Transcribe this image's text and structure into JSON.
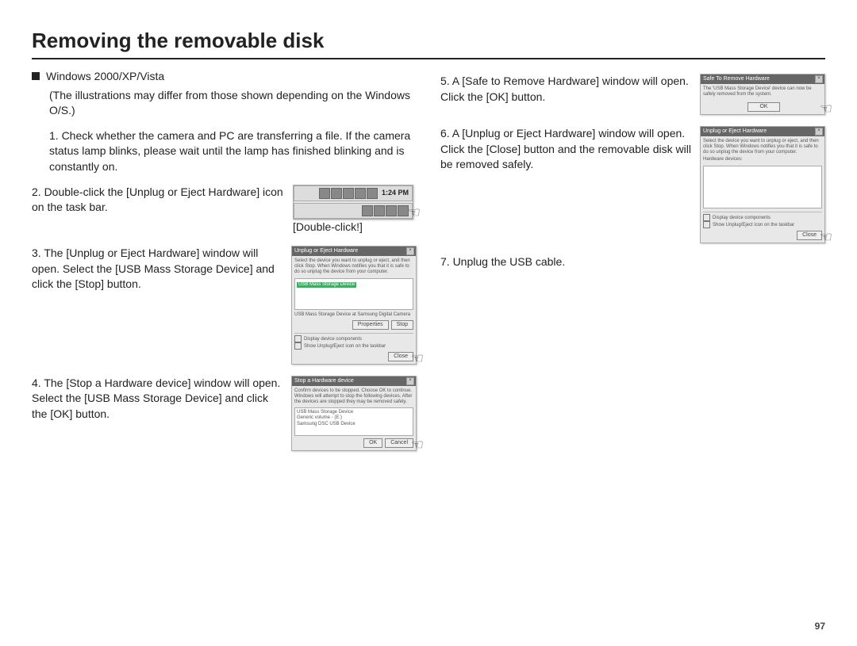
{
  "title": "Removing the removable disk",
  "page_number": "97",
  "left": {
    "platform": "Windows 2000/XP/Vista",
    "note": "(The illustrations may differ from those shown depending on the Windows O/S.)",
    "step1": "1. Check whether the camera and PC are transferring a file. If the camera status lamp blinks, please wait until the lamp has finished blinking and is constantly on.",
    "step2": "2. Double-click the [Unplug or Eject Hardware] icon on the task bar.",
    "taskbar_clock": "1:24 PM",
    "taskbar_caption": "[Double-click!]",
    "step3": "3. The [Unplug or Eject Hardware] window will open. Select the [USB Mass Storage Device] and click the [Stop] button.",
    "d3": {
      "title": "Unplug or Eject Hardware",
      "instr": "Select the device you want to unplug or eject, and then click Stop. When Windows notifies you that it is safe to do so unplug the device from your computer.",
      "list": "USB Mass Storage Device",
      "footer": "USB Mass Storage Device at Samsung Digital Camera",
      "check1": "Display device components",
      "check2": "Show Unplug/Eject icon on the taskbar",
      "btn_prop": "Properties",
      "btn_stop": "Stop",
      "btn_close": "Close"
    },
    "step4": "4. The [Stop a Hardware device] window will open. Select the [USB Mass Storage Device] and click the [OK] button.",
    "d4": {
      "title": "Stop a Hardware device",
      "instr": "Confirm devices to be stopped. Choose OK to continue. Windows will attempt to stop the following devices. After the devices are stopped they may be removed safely.",
      "item1": "USB Mass Storage Device",
      "item2": "Generic volume - (E:)",
      "item3": "Samsung DSC USB Device",
      "btn_ok": "OK",
      "btn_cancel": "Cancel"
    }
  },
  "right": {
    "step5": "5. A [Safe to Remove Hardware] window will open. Click the [OK] button.",
    "d5": {
      "title": "Safe To Remove Hardware",
      "msg": "The 'USB Mass Storage Device' device can now be safely removed from the system.",
      "btn_ok": "OK"
    },
    "step6": "6. A [Unplug or Eject Hardware] window will open. Click the [Close] button and the removable disk will be removed safely.",
    "d6": {
      "title": "Unplug or Eject Hardware",
      "instr": "Select the device you want to unplug or eject, and then click Stop. When Windows notifies you that it is safe to do so unplug the device from your computer.",
      "footer_label": "Hardware devices:",
      "check1": "Display device components",
      "check2": "Show Unplug/Eject icon on the taskbar",
      "btn_close": "Close"
    },
    "step7": "7. Unplug the USB cable."
  }
}
